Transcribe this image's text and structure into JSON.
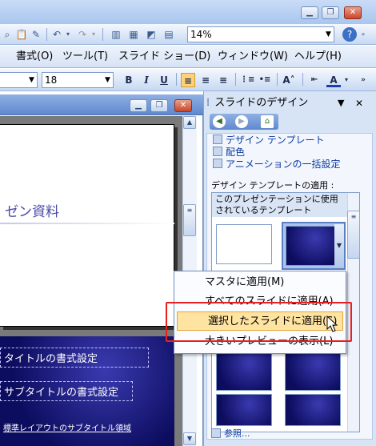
{
  "toolbar_top": {
    "zoom_value": "14%",
    "help_icon": "help-icon"
  },
  "menubar": {
    "items": [
      "書式(O)",
      "ツール(T)",
      "スライド ショー(D)",
      "ウィンドウ(W)",
      "ヘルプ(H)"
    ]
  },
  "format_toolbar": {
    "font_size": "18",
    "bold": "B",
    "italic": "I",
    "underline": "U"
  },
  "slide": {
    "title_text": "ゼン資料",
    "placeholder_title": "タイトルの書式設定",
    "placeholder_subtitle": "サブタイトルの書式設定",
    "footer_text": "標準レイアウトのサブタイトル領域"
  },
  "task_pane": {
    "title": "スライドのデザイン",
    "links": [
      "デザイン テンプレート",
      "配色",
      "アニメーションの一括設定"
    ],
    "apply_header": "デザイン テンプレートの適用 :",
    "template_group_header": "このプレゼンテーションに使用されているテンプレート",
    "reference_link": "参照..."
  },
  "context_menu": {
    "items": [
      {
        "label": "マスタに適用(M)",
        "highlighted": false
      },
      {
        "label": "すべてのスライドに適用(A)",
        "highlighted": false
      },
      {
        "label": "選択したスライドに適用(S)",
        "highlighted": true
      },
      {
        "label": "大きいプレビューの表示(L)",
        "highlighted": false
      }
    ]
  },
  "colors": {
    "highlight_fill": "#ffe3a0",
    "annotation_red": "#e62020",
    "link_blue": "#0a3a9f"
  }
}
